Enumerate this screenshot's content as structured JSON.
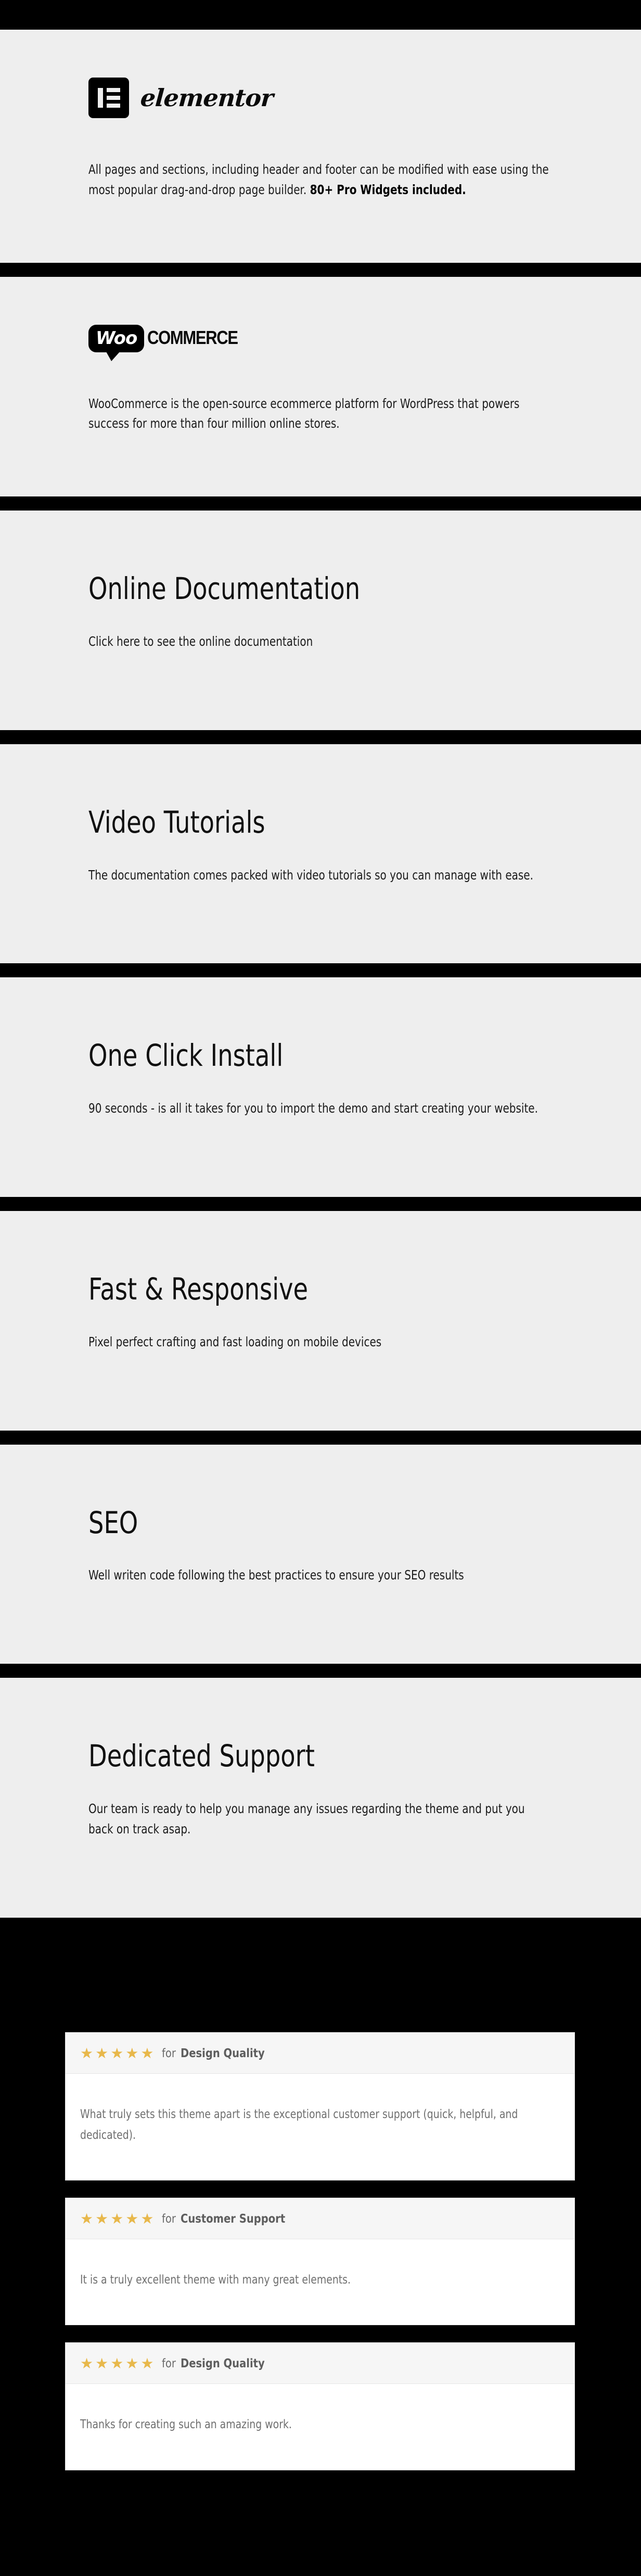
{
  "theme": {
    "panel_bg": "#eeeeee",
    "bar_color": "#000000",
    "star_color": "#e8b84b",
    "card_bg": "#ffffff",
    "card_head_bg": "#f6f6f6"
  },
  "sections": {
    "elementor": {
      "logo_name": "elementor",
      "wordmark": "elementor",
      "copy_plain_1": "All pages and sections, including header and footer can be modified with ease using the most popular drag-and-drop page builder. ",
      "copy_bold": "80+ Pro Widgets included."
    },
    "woocommerce": {
      "logo_woo": "Woo",
      "logo_commerce": "COMMERCE",
      "copy": "WooCommerce is the open-source ecommerce platform for WordPress that powers success for more than four million online stores."
    },
    "features": [
      {
        "title": "Online Documentation",
        "copy": "Click here to see the online documentation"
      },
      {
        "title": "Video Tutorials",
        "copy": "The documentation comes packed with video tutorials so you can manage with ease."
      },
      {
        "title": "One Click Install",
        "copy": "90 seconds - is all it takes for you to import the demo and start creating your website."
      },
      {
        "title": "Fast & Responsive",
        "copy": "Pixel perfect crafting and fast loading on mobile devices"
      },
      {
        "title": "SEO",
        "copy": "Well writen code following the best practices to ensure your SEO results"
      },
      {
        "title": "Dedicated Support",
        "copy": "Our team is ready to help you manage any issues regarding the theme and put you back on track asap."
      }
    ]
  },
  "testimonials": {
    "stars_glyphs": "★★★★★",
    "for_label": "for",
    "items": [
      {
        "stars": "★★★★★",
        "for_label": "for",
        "subject": "Design Quality",
        "text": "What truly sets this theme apart is the exceptional customer support (quick, helpful, and dedicated)."
      },
      {
        "stars": "★★★★★",
        "for_label": "for",
        "subject": "Customer Support",
        "text": "It is a truly excellent theme with many great elements."
      },
      {
        "stars": "★★★★★",
        "for_label": "for",
        "subject": "Design Quality",
        "text": "Thanks for creating such an amazing work."
      }
    ]
  }
}
